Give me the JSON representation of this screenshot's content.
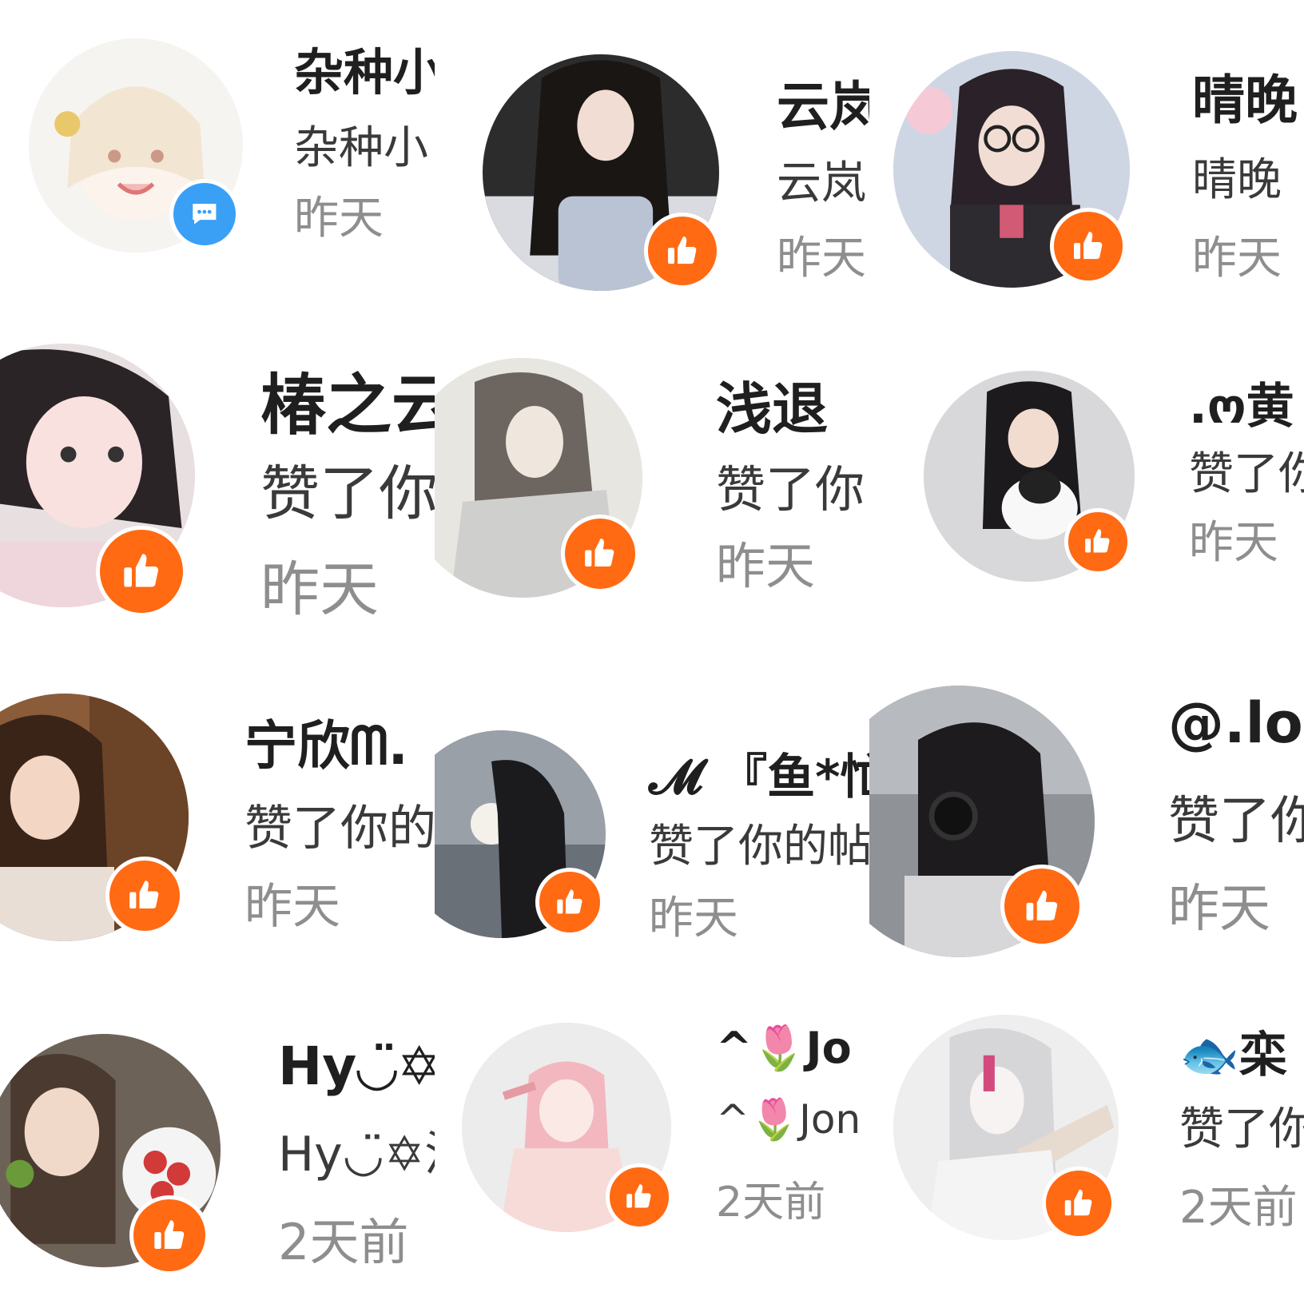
{
  "colors": {
    "like_badge": "#ff6a13",
    "message_badge": "#3aa0f5",
    "name": "#1f1f1f",
    "time": "#8e8e8e"
  },
  "notifications": [
    {
      "name": "杂种小",
      "sub": "杂种小",
      "time": "昨天",
      "badge": "message-icon"
    },
    {
      "name": "云岚",
      "sub": "云岚",
      "time": "昨天",
      "badge": "thumbs-up-icon"
    },
    {
      "name": "晴晚",
      "sub": "晴晚",
      "time": "昨天",
      "badge": "thumbs-up-icon"
    },
    {
      "name": "椿之云",
      "sub": "赞了你",
      "time": "昨天",
      "badge": "thumbs-up-icon"
    },
    {
      "name": "浅退",
      "sub": "赞了你",
      "time": "昨天",
      "badge": "thumbs-up-icon"
    },
    {
      "name": ".ო黄",
      "sub": "赞了你",
      "time": "昨天",
      "badge": "thumbs-up-icon"
    },
    {
      "name": "宁欣ᗰ.",
      "sub": "赞了你的",
      "time": "昨天",
      "badge": "thumbs-up-icon"
    },
    {
      "name": "𝓜 『鱼*忙",
      "sub": "赞了你的帖",
      "time": "昨天",
      "badge": "thumbs-up-icon"
    },
    {
      "name": "@.lo",
      "sub": "赞了你",
      "time": "昨天",
      "badge": "thumbs-up-icon"
    },
    {
      "name": "Hy◡̈✡",
      "sub": "Hy◡̈✡温",
      "time": "2天前",
      "badge": "thumbs-up-icon"
    },
    {
      "name": "^🌷Jo",
      "sub": "^🌷Jon",
      "time": "2天前",
      "badge": "thumbs-up-icon"
    },
    {
      "name": "🐟栾",
      "sub": "赞了你",
      "time": "2天前",
      "badge": "thumbs-up-icon"
    }
  ]
}
